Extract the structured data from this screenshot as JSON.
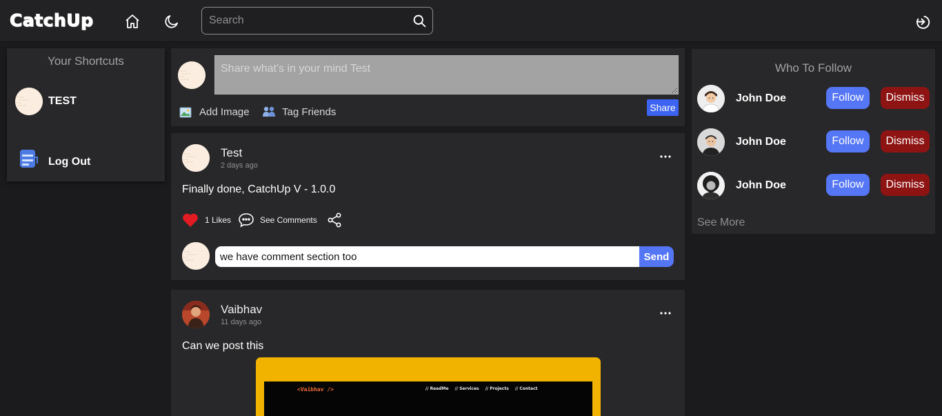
{
  "navbar": {
    "logo": "CatchUp",
    "search_placeholder": "Search",
    "icons": [
      "home-icon",
      "moon-icon",
      "search-icon",
      "logout-icon"
    ]
  },
  "shortcuts": {
    "title": "Your Shortcuts",
    "items": [
      {
        "label": "TEST",
        "icon": "avatar"
      },
      {
        "label": "Log Out",
        "icon": "logout-icon"
      }
    ]
  },
  "composer": {
    "placeholder": "Share what's in your mind Test",
    "add_image": "Add Image",
    "tag_friends": "Tag Friends",
    "share": "Share"
  },
  "posts": [
    {
      "author": "Test",
      "time": "2 days ago",
      "text": "Finally done, CatchUp V - 1.0.0",
      "likes": "1 Likes",
      "see_comments": "See Comments",
      "comment_value": "we have comment section too",
      "send": "Send"
    },
    {
      "author": "Vaibhav",
      "time": "11 days ago",
      "text": "Can we post this",
      "image": {
        "brand": "<Vaibhav />",
        "links": [
          "// ReadMe",
          "// Services",
          "// Projects",
          "// Contact"
        ]
      }
    }
  ],
  "who_to_follow": {
    "title": "Who To Follow",
    "people": [
      {
        "name": "John Doe",
        "follow": "Follow",
        "dismiss": "Dismiss"
      },
      {
        "name": "John Doe",
        "follow": "Follow",
        "dismiss": "Dismiss"
      },
      {
        "name": "John Doe",
        "follow": "Follow",
        "dismiss": "Dismiss"
      }
    ],
    "see_more": "See More"
  },
  "colors": {
    "background": "#1b1b1d",
    "panel": "#28282a",
    "accent_blue": "#5576f5",
    "dismiss_red": "#8e1313",
    "like_red": "#e31b23",
    "banner_yellow": "#f1b300"
  }
}
